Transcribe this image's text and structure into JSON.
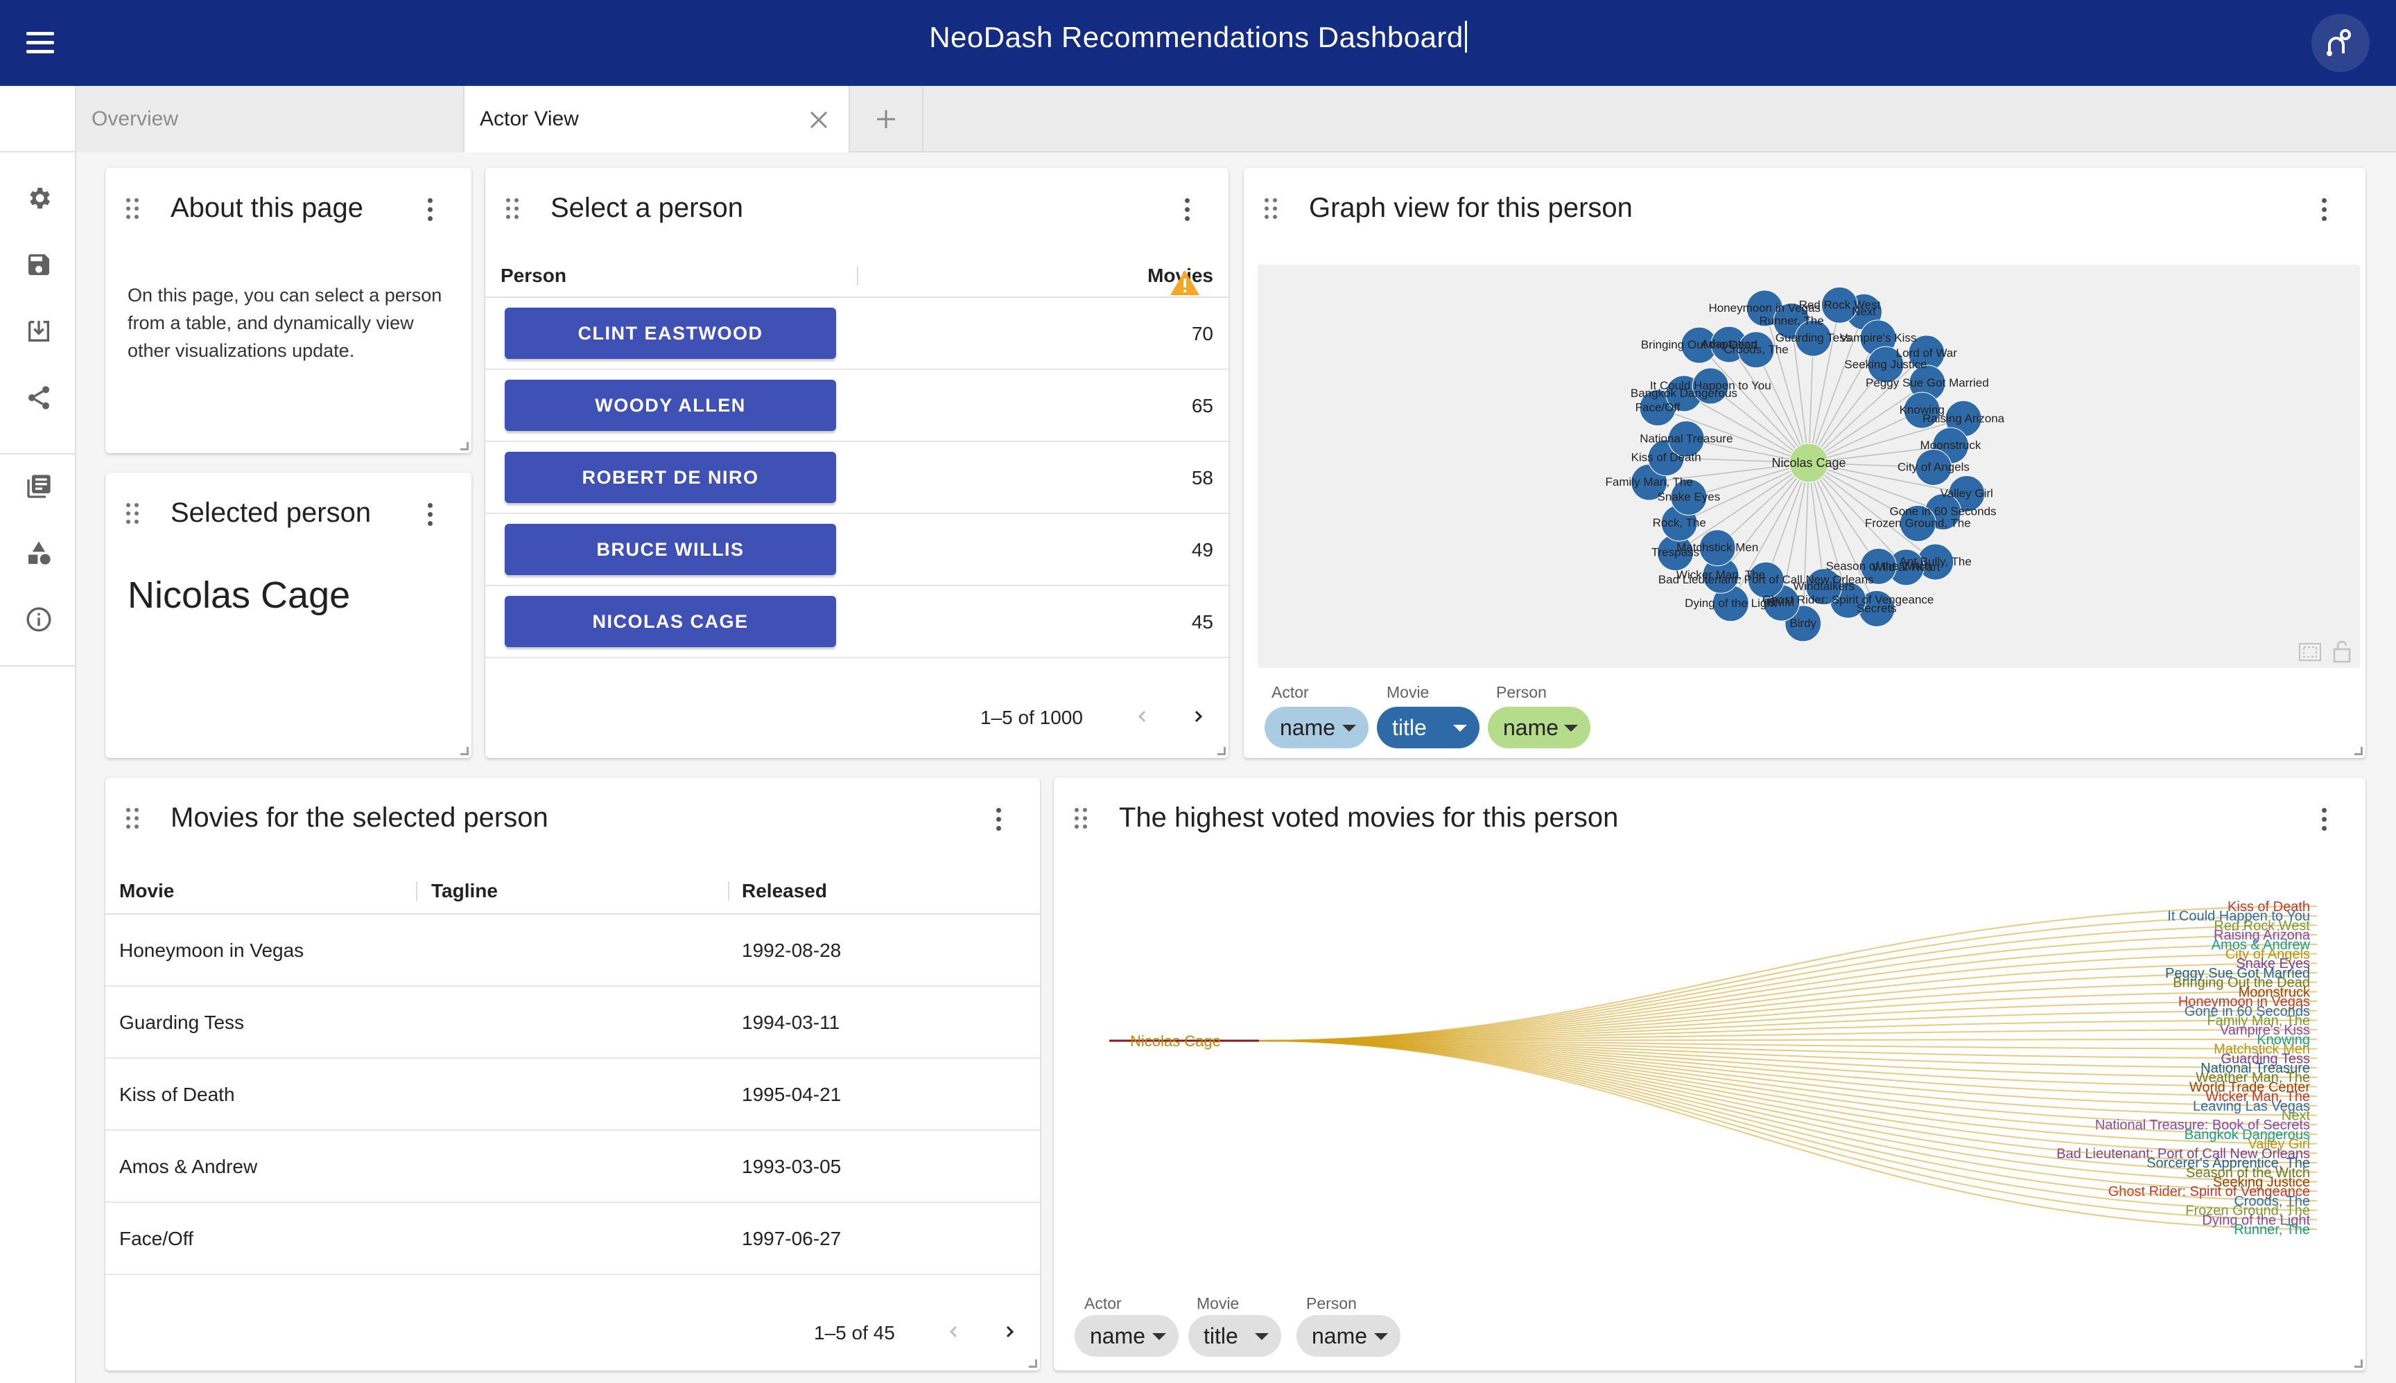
{
  "app": {
    "title": "NeoDash Recommendations Dashboard"
  },
  "tabs": [
    {
      "label": "Overview"
    },
    {
      "label": "Actor View"
    }
  ],
  "cards": {
    "about": {
      "title": "About this page",
      "text": "On this page, you can select a person from a table, and dynamically view other visualizations update."
    },
    "selected": {
      "title": "Selected person",
      "name": "Nicolas Cage"
    },
    "select": {
      "title": "Select a person",
      "columns": [
        "Person",
        "Movies"
      ],
      "rows": [
        {
          "person": "CLINT EASTWOOD",
          "movies": "70"
        },
        {
          "person": "WOODY ALLEN",
          "movies": "65"
        },
        {
          "person": "ROBERT DE NIRO",
          "movies": "58"
        },
        {
          "person": "BRUCE WILLIS",
          "movies": "49"
        },
        {
          "person": "NICOLAS CAGE",
          "movies": "45"
        }
      ],
      "pagination": "1–5 of 1000"
    },
    "graph": {
      "title": "Graph view for this person",
      "center": "Nicolas Cage",
      "movies": [
        "Next",
        "Vampire's Kiss",
        "Seeking Justice",
        "Lord of War",
        "Peggy Sue Got Married",
        "Knowing",
        "Raising Arizona",
        "Moonstruck",
        "City of Angels",
        "Valley Girl",
        "Gone in 60 Seconds",
        "Frozen Ground, The",
        "Ant Bully, The",
        "Wild at Heart",
        "Season of the Witch",
        "Secrets",
        "Ghost Rider: Spirit of Vengeance",
        "Windtalkers",
        "Birdy",
        "8MM",
        "Bad Lieutenant: Port of Call New Orleans",
        "Dying of the Light",
        "Wicker Man, The",
        "Matchstick Men",
        "Trespass",
        "Rock, The",
        "Snake Eyes",
        "Family Man, The",
        "Kiss of Death",
        "National Treasure",
        "Face/Off",
        "Bangkok Dangerous",
        "It Could Happen to You",
        "Bringing Out the Dead",
        "Adaptation",
        "Croods, The",
        "Honeymoon in Vegas",
        "Runner, The",
        "Guarding Tess",
        "Red Rock West"
      ],
      "legend": [
        {
          "label": "Actor",
          "value": "name",
          "color": "#a9cce3"
        },
        {
          "label": "Movie",
          "value": "title",
          "color": "#2f6aa8"
        },
        {
          "label": "Person",
          "value": "name",
          "color": "#b5dc8a"
        }
      ]
    },
    "movies": {
      "title": "Movies for the selected person",
      "columns": [
        "Movie",
        "Tagline",
        "Released"
      ],
      "rows": [
        {
          "movie": "Honeymoon in Vegas",
          "tagline": "",
          "released": "1992-08-28"
        },
        {
          "movie": "Guarding Tess",
          "tagline": "",
          "released": "1994-03-11"
        },
        {
          "movie": "Kiss of Death",
          "tagline": "",
          "released": "1995-04-21"
        },
        {
          "movie": "Amos & Andrew",
          "tagline": "",
          "released": "1993-03-05"
        },
        {
          "movie": "Face/Off",
          "tagline": "",
          "released": "1997-06-27"
        }
      ],
      "pagination": "1–5 of 45"
    },
    "voted": {
      "title": "The highest voted movies for this person",
      "source": "Nicolas Cage",
      "targets": [
        "Kiss of Death",
        "It Could Happen to You",
        "Red Rock West",
        "Raising Arizona",
        "Amos & Andrew",
        "City of Angels",
        "Snake Eyes",
        "Peggy Sue Got Married",
        "Bringing Out the Dead",
        "Moonstruck",
        "Honeymoon in Vegas",
        "Gone in 60 Seconds",
        "Family Man, The",
        "Vampire's Kiss",
        "Knowing",
        "Matchstick Men",
        "Guarding Tess",
        "National Treasure",
        "Weather Man, The",
        "World Trade Center",
        "Wicker Man, The",
        "Leaving Las Vegas",
        "Next",
        "National Treasure: Book of Secrets",
        "Bangkok Dangerous",
        "Valley Girl",
        "Bad Lieutenant: Port of Call New Orleans",
        "Sorcerer's Apprentice, The",
        "Season of the Witch",
        "Seeking Justice",
        "Ghost Rider: Spirit of Vengeance",
        "Croods, The",
        "Frozen Ground, The",
        "Dying of the Light",
        "Runner, The"
      ],
      "legend": [
        {
          "label": "Actor",
          "value": "name",
          "color": "#e0e0e0"
        },
        {
          "label": "Movie",
          "value": "title",
          "color": "#e0e0e0"
        },
        {
          "label": "Person",
          "value": "name",
          "color": "#e0e0e0"
        }
      ]
    }
  },
  "icons": [
    "menu-icon",
    "connection-icon",
    "settings-icon",
    "save-icon",
    "load-icon",
    "share-icon",
    "documentation-icon",
    "extensions-icon",
    "info-icon",
    "close-icon",
    "add-icon",
    "drag-handle-icon",
    "more-vert-icon",
    "warning-icon",
    "chevron-left-icon",
    "chevron-right-icon",
    "fullscreen-icon",
    "lock-icon"
  ]
}
